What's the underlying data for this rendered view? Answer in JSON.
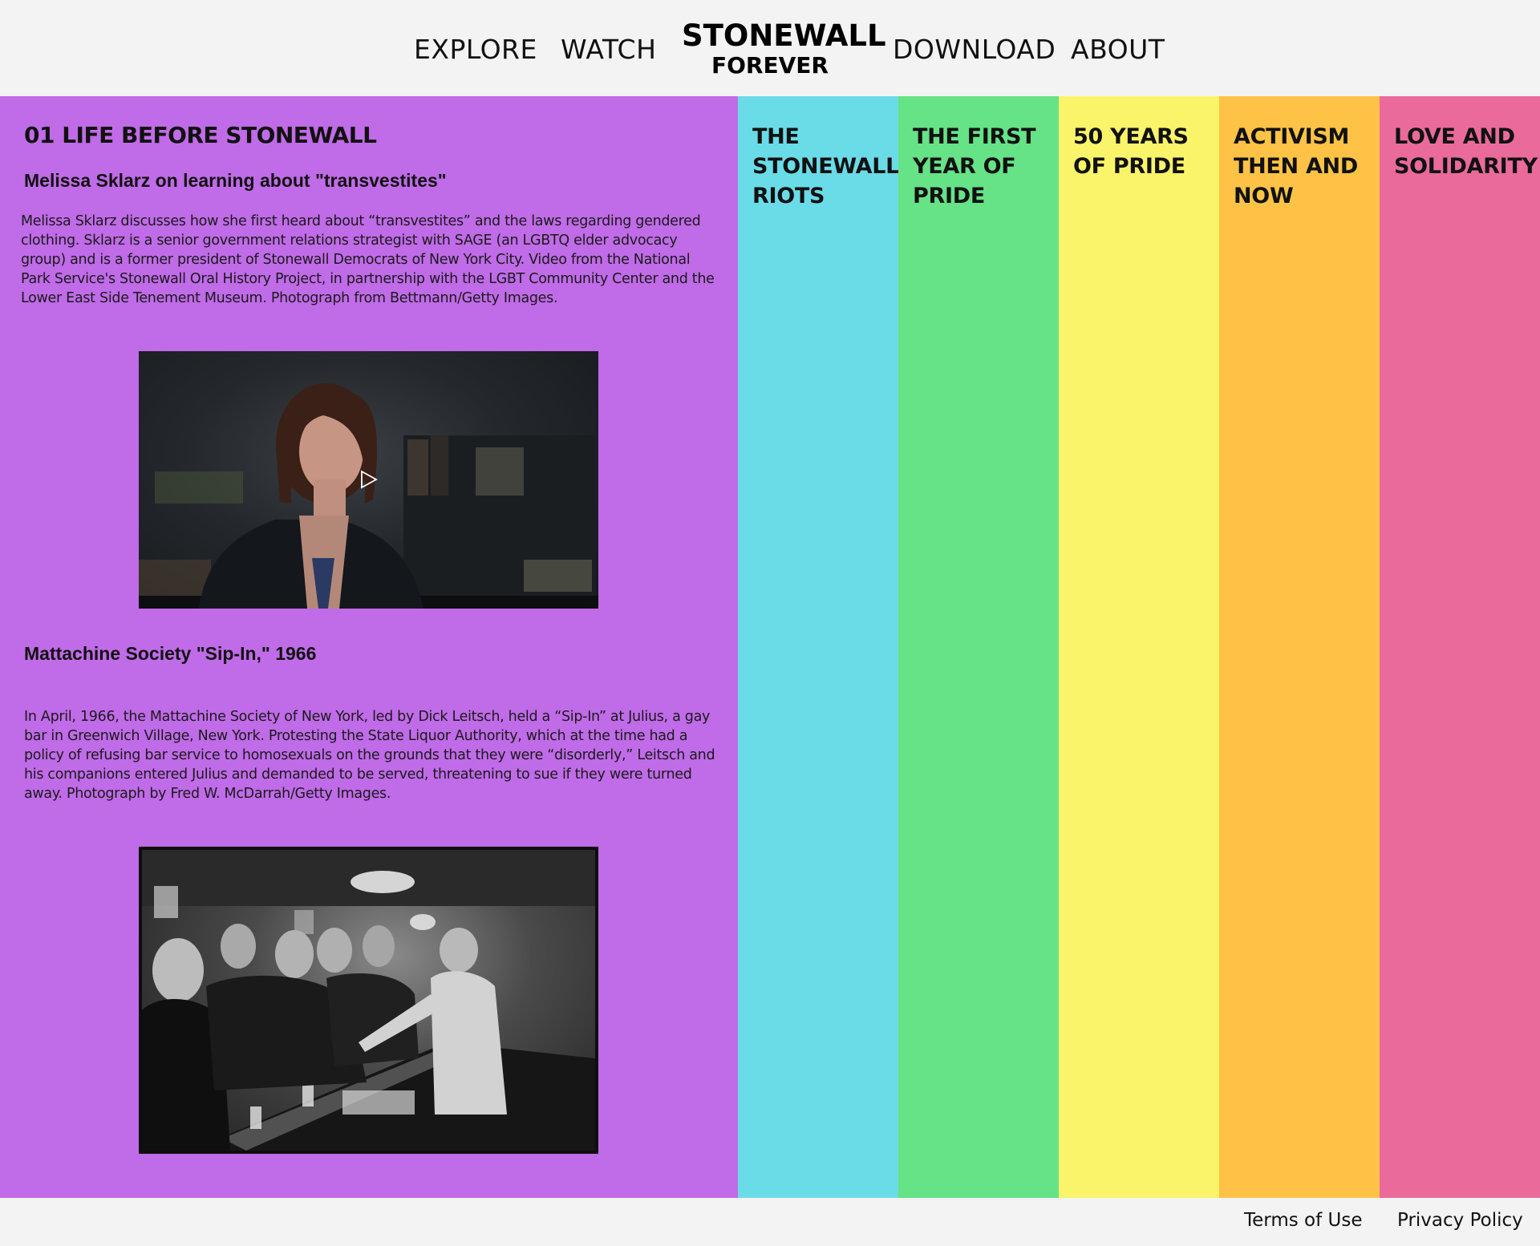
{
  "nav": {
    "explore": "EXPLORE",
    "watch": "WATCH",
    "logo_line1": "STONEWALL",
    "logo_line2": "FOREVER",
    "download": "DOWNLOAD",
    "about": "ABOUT"
  },
  "active_section": {
    "title": "01 LIFE BEFORE STONEWALL",
    "color": "#c06be8",
    "items": [
      {
        "title": "Melissa Sklarz on learning about \"transvestites\"",
        "description": "Melissa Sklarz discusses how she first heard about “transvestites” and the laws regarding gendered clothing. Sklarz is a senior government relations strategist with SAGE (an LGBTQ elder advocacy group) and is a former president of Stonewall Democrats of New York City. Video from the National Park Service's Stonewall Oral History Project, in partnership with the LGBT Community Center and the Lower East Side Tenement Museum. Photograph from Bettmann/Getty Images.",
        "media": "video",
        "play_icon": "play-icon"
      },
      {
        "title": "Mattachine Society \"Sip-In,\" 1966",
        "description": "In April, 1966, the Mattachine Society of New York, led by Dick Leitsch, held a “Sip-In” at Julius, a gay bar in Greenwich Village, New York. Protesting the State Liquor Authority, which at the time had a policy of refusing bar service to homosexuals on the grounds that they were “disorderly,” Leitsch and his companions entered Julius and demanded to be served, threatening to sue if they were turned away. Photograph by Fred W. McDarrah/Getty Images.",
        "media": "photo"
      }
    ]
  },
  "sections": [
    {
      "label": "THE STONEWALL RIOTS",
      "color": "#6adce8"
    },
    {
      "label": "THE FIRST YEAR OF PRIDE",
      "color": "#66e287"
    },
    {
      "label": "50 YEARS OF PRIDE",
      "color": "#f9f46a"
    },
    {
      "label": "ACTIVISM THEN AND NOW",
      "color": "#fec346"
    },
    {
      "label": "LOVE AND SOLIDARITY",
      "color": "#ea6a9c"
    }
  ],
  "footer": {
    "terms": "Terms of Use",
    "privacy": "Privacy Policy"
  }
}
